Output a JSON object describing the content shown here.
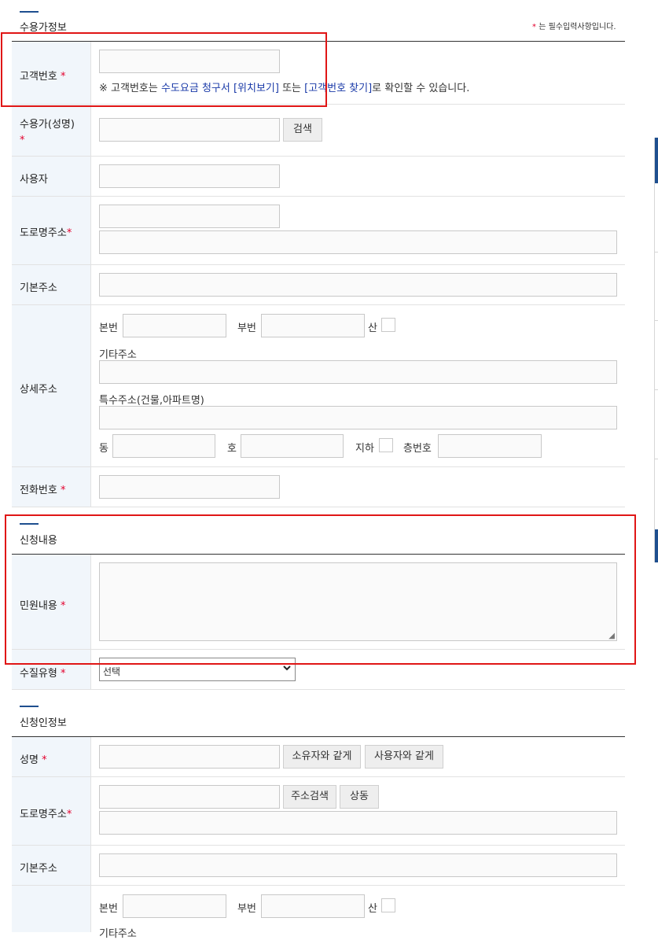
{
  "customer_info": {
    "title": "수용가정보",
    "required_note_star": "*",
    "required_note": "는 필수입력사항입니다.",
    "customer_no": {
      "label": "고객번호",
      "star": "*",
      "note_prefix": "※ 고객번호는 ",
      "note_link1": "수도요금 청구서 [위치보기]",
      "note_mid": " 또는 ",
      "note_link2": "[고객번호 찾기]",
      "note_suffix": "로 확인할 수 있습니다."
    },
    "name": {
      "label": "수용가(성명)",
      "star": "*",
      "search_button": "검색"
    },
    "user": {
      "label": "사용자"
    },
    "road_address": {
      "label": "도로명주소",
      "star": "*"
    },
    "basic_address": {
      "label": "기본주소"
    },
    "detail_address": {
      "label": "상세주소",
      "main_no": "본번",
      "sub_no": "부번",
      "mountain": "산",
      "other_address": "기타주소",
      "special_address": "특수주소(건물,아파트명)",
      "dong": "동",
      "ho": "호",
      "basement": "지하",
      "floor_no": "층번호"
    },
    "phone": {
      "label": "전화번호",
      "star": "*"
    }
  },
  "application": {
    "title": "신청내용",
    "complaint": {
      "label": "민원내용",
      "star": "*"
    },
    "water_quality_type": {
      "label": "수질유형",
      "star": "*",
      "selected": "선택"
    }
  },
  "applicant": {
    "title": "신청인정보",
    "name": {
      "label": "성명",
      "star": "*",
      "same_owner_button": "소유자와 같게",
      "same_user_button": "사용자와 같게"
    },
    "road_address": {
      "label": "도로명주소",
      "star": "*",
      "address_search_button": "주소검색",
      "same_button": "상동"
    },
    "basic_address": {
      "label": "기본주소"
    },
    "detail_address": {
      "main_no": "본번",
      "sub_no": "부번",
      "mountain": "산",
      "other_address": "기타주소"
    }
  }
}
